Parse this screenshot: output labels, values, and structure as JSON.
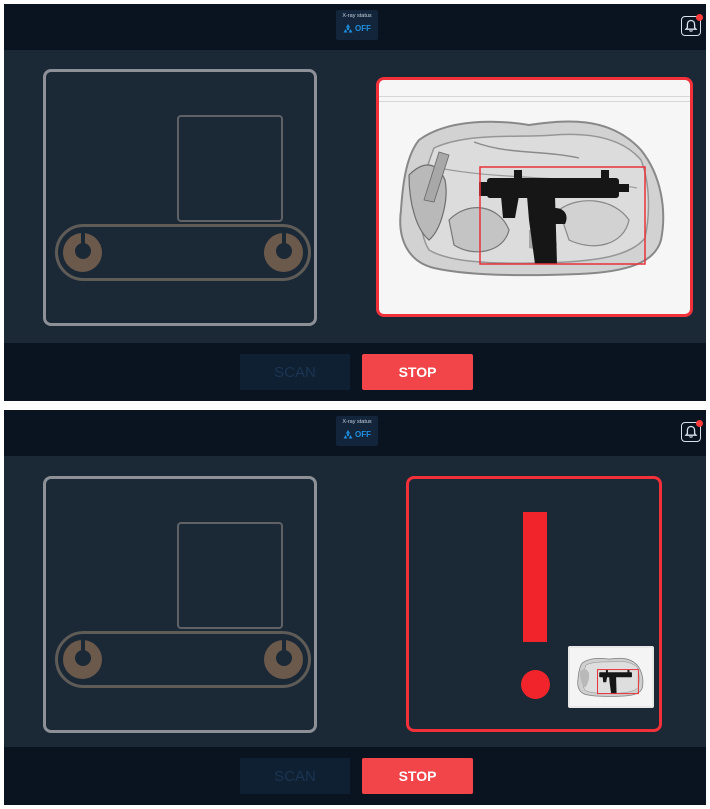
{
  "colors": {
    "screen_bg": "#1b2836",
    "bar_bg": "#0a1421",
    "alert_red": "#f2303a",
    "status_blue": "#1e8fe0",
    "stop_red": "#f24549"
  },
  "screens": [
    {
      "state": "threat-detected-xray-view",
      "xray_status": {
        "label": "X-ray status",
        "value": "OFF",
        "icon": "radiation-icon"
      },
      "notification_icon": "bell-icon",
      "scan_label": "SCAN",
      "stop_label": "STOP"
    },
    {
      "state": "threat-alert-view",
      "xray_status": {
        "label": "X-ray status",
        "value": "OFF",
        "icon": "radiation-icon"
      },
      "notification_icon": "bell-icon",
      "alert_icon": "exclamation-icon",
      "scan_label": "SCAN",
      "stop_label": "STOP"
    }
  ]
}
